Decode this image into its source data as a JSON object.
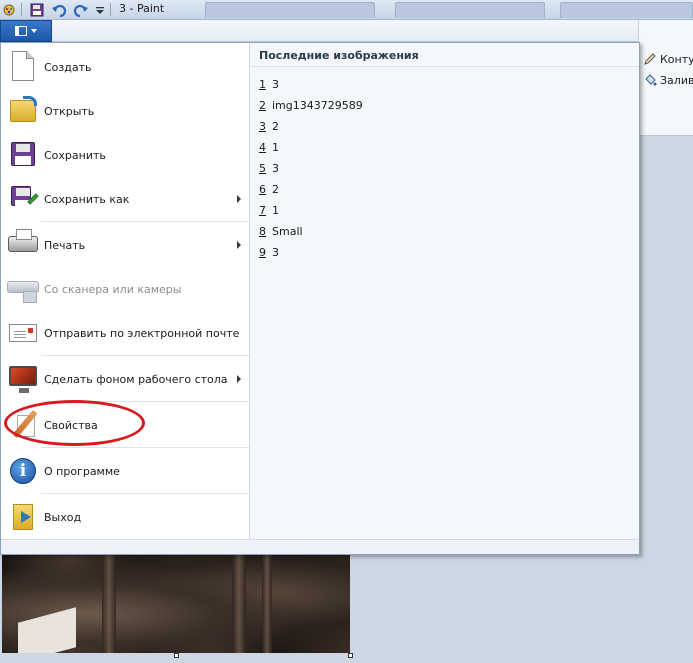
{
  "window": {
    "title": "3 - Paint"
  },
  "ribbon": {
    "outline_label": "Контур",
    "fill_label": "Заливка"
  },
  "app_menu": {
    "items": [
      {
        "label": "Создать",
        "icon": "new-document-icon",
        "submenu": false,
        "enabled": true
      },
      {
        "label": "Открыть",
        "icon": "open-folder-icon",
        "submenu": false,
        "enabled": true
      },
      {
        "label": "Сохранить",
        "icon": "save-icon",
        "submenu": false,
        "enabled": true
      },
      {
        "label": "Сохранить как",
        "icon": "save-as-icon",
        "submenu": true,
        "enabled": true
      },
      {
        "label": "Печать",
        "icon": "printer-icon",
        "submenu": true,
        "enabled": true
      },
      {
        "label": "Со сканера или камеры",
        "icon": "scanner-icon",
        "submenu": false,
        "enabled": false
      },
      {
        "label": "Отправить по электронной почте",
        "icon": "email-icon",
        "submenu": false,
        "enabled": true
      },
      {
        "label": "Сделать фоном рабочего стола",
        "icon": "desktop-background-icon",
        "submenu": true,
        "enabled": true
      },
      {
        "label": "Свойства",
        "icon": "properties-icon",
        "submenu": false,
        "enabled": true
      },
      {
        "label": "О программе",
        "icon": "info-icon",
        "submenu": false,
        "enabled": true
      },
      {
        "label": "Выход",
        "icon": "exit-icon",
        "submenu": false,
        "enabled": true
      }
    ],
    "recent": {
      "title": "Последние изображения",
      "items": [
        {
          "num": "1",
          "name": "3"
        },
        {
          "num": "2",
          "name": "img1343729589"
        },
        {
          "num": "3",
          "name": "2"
        },
        {
          "num": "4",
          "name": "1"
        },
        {
          "num": "5",
          "name": "3"
        },
        {
          "num": "6",
          "name": "2"
        },
        {
          "num": "7",
          "name": "1"
        },
        {
          "num": "8",
          "name": "Small"
        },
        {
          "num": "9",
          "name": "3"
        }
      ]
    }
  },
  "colors": {
    "menu_button": "#1d57a8",
    "highlight_circle": "#d8191f"
  }
}
